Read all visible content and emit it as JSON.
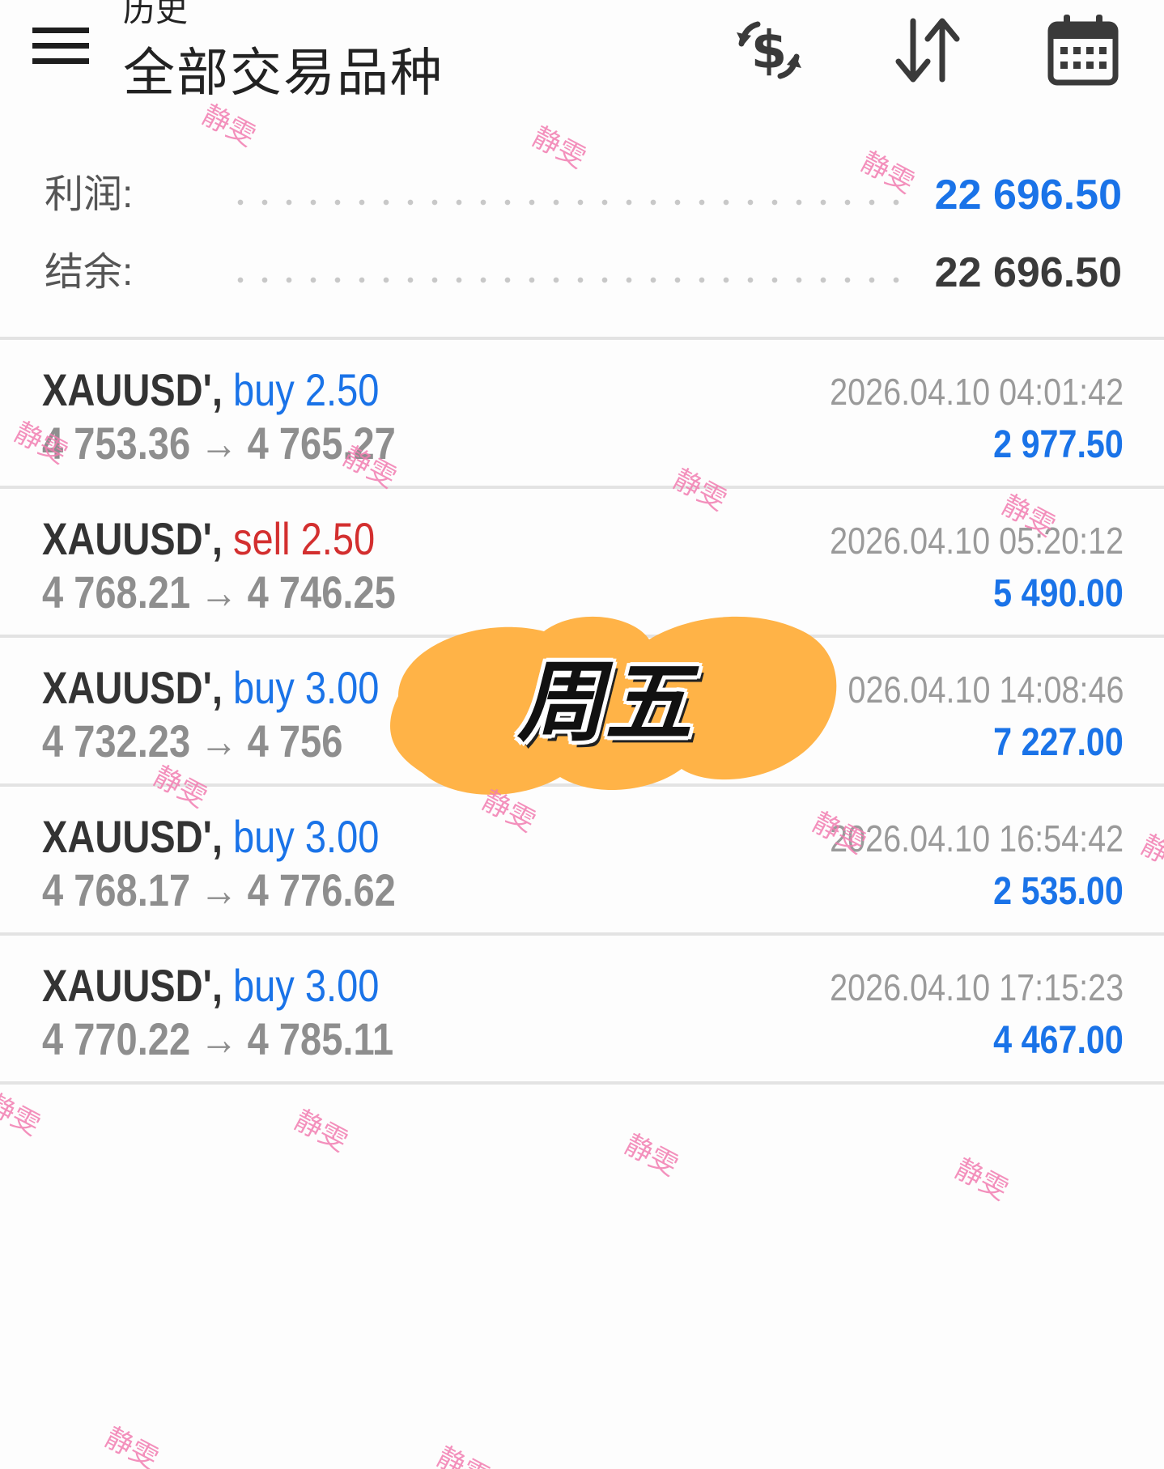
{
  "header": {
    "subtitle": "历史",
    "title": "全部交易品种",
    "icons": [
      "menu-icon",
      "currency-exchange-icon",
      "sort-icon",
      "calendar-icon"
    ]
  },
  "summary": {
    "profit_label": "利润:",
    "profit_value": "22 696.50",
    "balance_label": "结余:",
    "balance_value": "22 696.50"
  },
  "trades": [
    {
      "symbol": "XAUUSD'",
      "side": "buy",
      "volume": "2.50",
      "open": "4 753.36",
      "close": "4 765.27",
      "time": "2026.04.10 04:01:42",
      "profit": "2 977.50"
    },
    {
      "symbol": "XAUUSD'",
      "side": "sell",
      "volume": "2.50",
      "open": "4 768.21",
      "close": "4 746.25",
      "time": "2026.04.10 05:20:12",
      "profit": "5 490.00"
    },
    {
      "symbol": "XAUUSD'",
      "side": "buy",
      "volume": "3.00",
      "open": "4 732.23",
      "close": "4 756",
      "time": "026.04.10 14:08:46",
      "profit": "7 227.00"
    },
    {
      "symbol": "XAUUSD'",
      "side": "buy",
      "volume": "3.00",
      "open": "4 768.17",
      "close": "4 776.62",
      "time": "2026.04.10 16:54:42",
      "profit": "2 535.00"
    },
    {
      "symbol": "XAUUSD'",
      "side": "buy",
      "volume": "3.00",
      "open": "4 770.22",
      "close": "4 785.11",
      "time": "2026.04.10 17:15:23",
      "profit": "4 467.00"
    }
  ],
  "separator": ",",
  "arrow": "→",
  "overlay_label": "周五",
  "watermark_text": "静雯",
  "colors": {
    "buy": "#1a73e8",
    "sell": "#d32f2f",
    "profit": "#1a73e8",
    "balance": "#3a3a3a",
    "sticker": "#ffb347",
    "watermark": "#f27db1"
  }
}
